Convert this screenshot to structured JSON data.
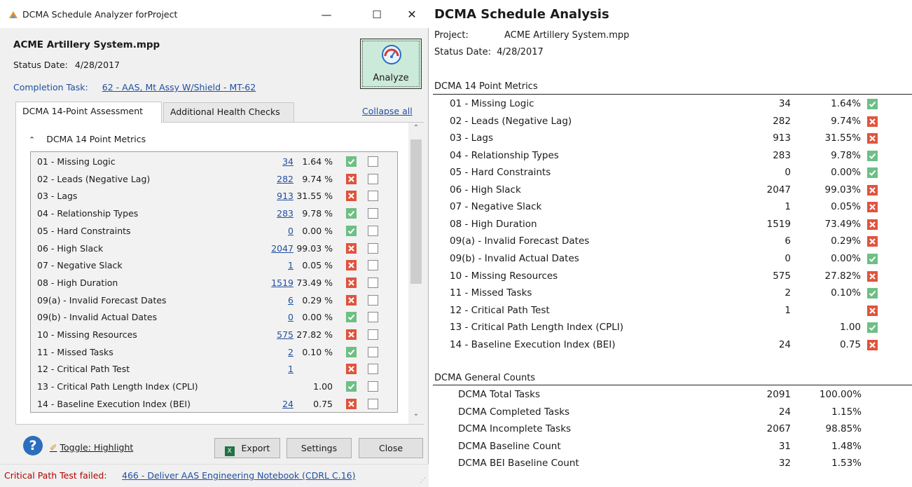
{
  "window": {
    "title": "DCMA Schedule Analyzer forProject",
    "minimize": "—",
    "maximize": "☐",
    "close": "✕"
  },
  "project": {
    "file_name": "ACME Artillery System.mpp",
    "status_date_label": "Status Date:",
    "status_date": "4/28/2017",
    "completion_label": "Completion Task:",
    "completion_task": "62 - AAS, Mt Assy W/Shield - MT-62"
  },
  "analyze_button": {
    "label": "Analyze",
    "icon": "gauge-icon"
  },
  "tabs": [
    {
      "label": "DCMA 14-Point Assessment",
      "active": true
    },
    {
      "label": "Additional Health Checks",
      "active": false
    }
  ],
  "collapse_all": "Collapse all",
  "section_title": "DCMA 14 Point Metrics",
  "metrics": [
    {
      "name": "01 - Missing Logic",
      "count": "34",
      "pct": "1.64 %",
      "status": "pass"
    },
    {
      "name": "02 - Leads (Negative Lag)",
      "count": "282",
      "pct": "9.74 %",
      "status": "fail"
    },
    {
      "name": "03 - Lags",
      "count": "913",
      "pct": "31.55 %",
      "status": "fail"
    },
    {
      "name": "04 - Relationship Types",
      "count": "283",
      "pct": "9.78 %",
      "status": "pass"
    },
    {
      "name": "05 - Hard Constraints",
      "count": "0",
      "pct": "0.00 %",
      "status": "pass"
    },
    {
      "name": "06 - High Slack",
      "count": "2047",
      "pct": "99.03 %",
      "status": "fail"
    },
    {
      "name": "07 - Negative Slack",
      "count": "1",
      "pct": "0.05 %",
      "status": "fail"
    },
    {
      "name": "08 - High Duration",
      "count": "1519",
      "pct": "73.49 %",
      "status": "fail"
    },
    {
      "name": "09(a) - Invalid Forecast Dates",
      "count": "6",
      "pct": "0.29 %",
      "status": "fail"
    },
    {
      "name": "09(b) - Invalid Actual Dates",
      "count": "0",
      "pct": "0.00 %",
      "status": "pass"
    },
    {
      "name": "10 - Missing Resources",
      "count": "575",
      "pct": "27.82 %",
      "status": "fail"
    },
    {
      "name": "11 - Missed Tasks",
      "count": "2",
      "pct": "0.10 %",
      "status": "pass"
    },
    {
      "name": "12 - Critical Path Test",
      "count": "1",
      "pct": "",
      "status": "fail"
    },
    {
      "name": "13 - Critical Path Length Index (CPLI)",
      "count": "",
      "pct": "1.00",
      "status": "pass"
    },
    {
      "name": "14 - Baseline Execution Index (BEI)",
      "count": "24",
      "pct": "0.75",
      "status": "fail"
    }
  ],
  "toolbar": {
    "toggle_highlight": "Toggle: Highlight",
    "export": "Export",
    "settings": "Settings",
    "close": "Close"
  },
  "statusbar": {
    "label": "Critical Path Test failed:",
    "link": "466 - Deliver AAS Engineering Notebook (CDRL C.16)"
  },
  "report": {
    "title": "DCMA Schedule Analysis",
    "project_label": "Project:",
    "project_value": "ACME Artillery System.mpp",
    "status_label": "Status Date:",
    "status_value": "4/28/2017",
    "metrics_title": "DCMA 14 Point Metrics",
    "metrics": [
      {
        "name": "01 - Missing Logic",
        "count": "34",
        "pct": "1.64%",
        "status": "pass"
      },
      {
        "name": "02 - Leads (Negative Lag)",
        "count": "282",
        "pct": "9.74%",
        "status": "fail"
      },
      {
        "name": "03 - Lags",
        "count": "913",
        "pct": "31.55%",
        "status": "fail"
      },
      {
        "name": "04 - Relationship Types",
        "count": "283",
        "pct": "9.78%",
        "status": "pass"
      },
      {
        "name": "05 - Hard Constraints",
        "count": "0",
        "pct": "0.00%",
        "status": "pass"
      },
      {
        "name": "06 - High Slack",
        "count": "2047",
        "pct": "99.03%",
        "status": "fail"
      },
      {
        "name": "07 - Negative Slack",
        "count": "1",
        "pct": "0.05%",
        "status": "fail"
      },
      {
        "name": "08 - High Duration",
        "count": "1519",
        "pct": "73.49%",
        "status": "fail"
      },
      {
        "name": "09(a) - Invalid Forecast Dates",
        "count": "6",
        "pct": "0.29%",
        "status": "fail"
      },
      {
        "name": "09(b) - Invalid Actual Dates",
        "count": "0",
        "pct": "0.00%",
        "status": "pass"
      },
      {
        "name": "10 - Missing Resources",
        "count": "575",
        "pct": "27.82%",
        "status": "fail"
      },
      {
        "name": "11 - Missed Tasks",
        "count": "2",
        "pct": "0.10%",
        "status": "pass"
      },
      {
        "name": "12 - Critical Path Test",
        "count": "1",
        "pct": "",
        "status": "fail"
      },
      {
        "name": "13 - Critical Path Length Index (CPLI)",
        "count": "",
        "pct": "1.00",
        "status": "pass"
      },
      {
        "name": "14 - Baseline Execution Index (BEI)",
        "count": "24",
        "pct": "0.75",
        "status": "fail"
      }
    ],
    "general_title": "DCMA General Counts",
    "general": [
      {
        "name": "DCMA Total Tasks",
        "count": "2091",
        "pct": "100.00%"
      },
      {
        "name": "DCMA Completed Tasks",
        "count": "24",
        "pct": "1.15%"
      },
      {
        "name": "DCMA Incomplete Tasks",
        "count": "2067",
        "pct": "98.85%"
      },
      {
        "name": "DCMA Baseline Count",
        "count": "31",
        "pct": "1.48%"
      },
      {
        "name": "DCMA BEI Baseline Count",
        "count": "32",
        "pct": "1.53%"
      }
    ]
  },
  "colors": {
    "pass": "#6ebf85",
    "fail": "#e0533d",
    "link": "#1f4fa0",
    "analyze_bg": "#ccead9"
  }
}
